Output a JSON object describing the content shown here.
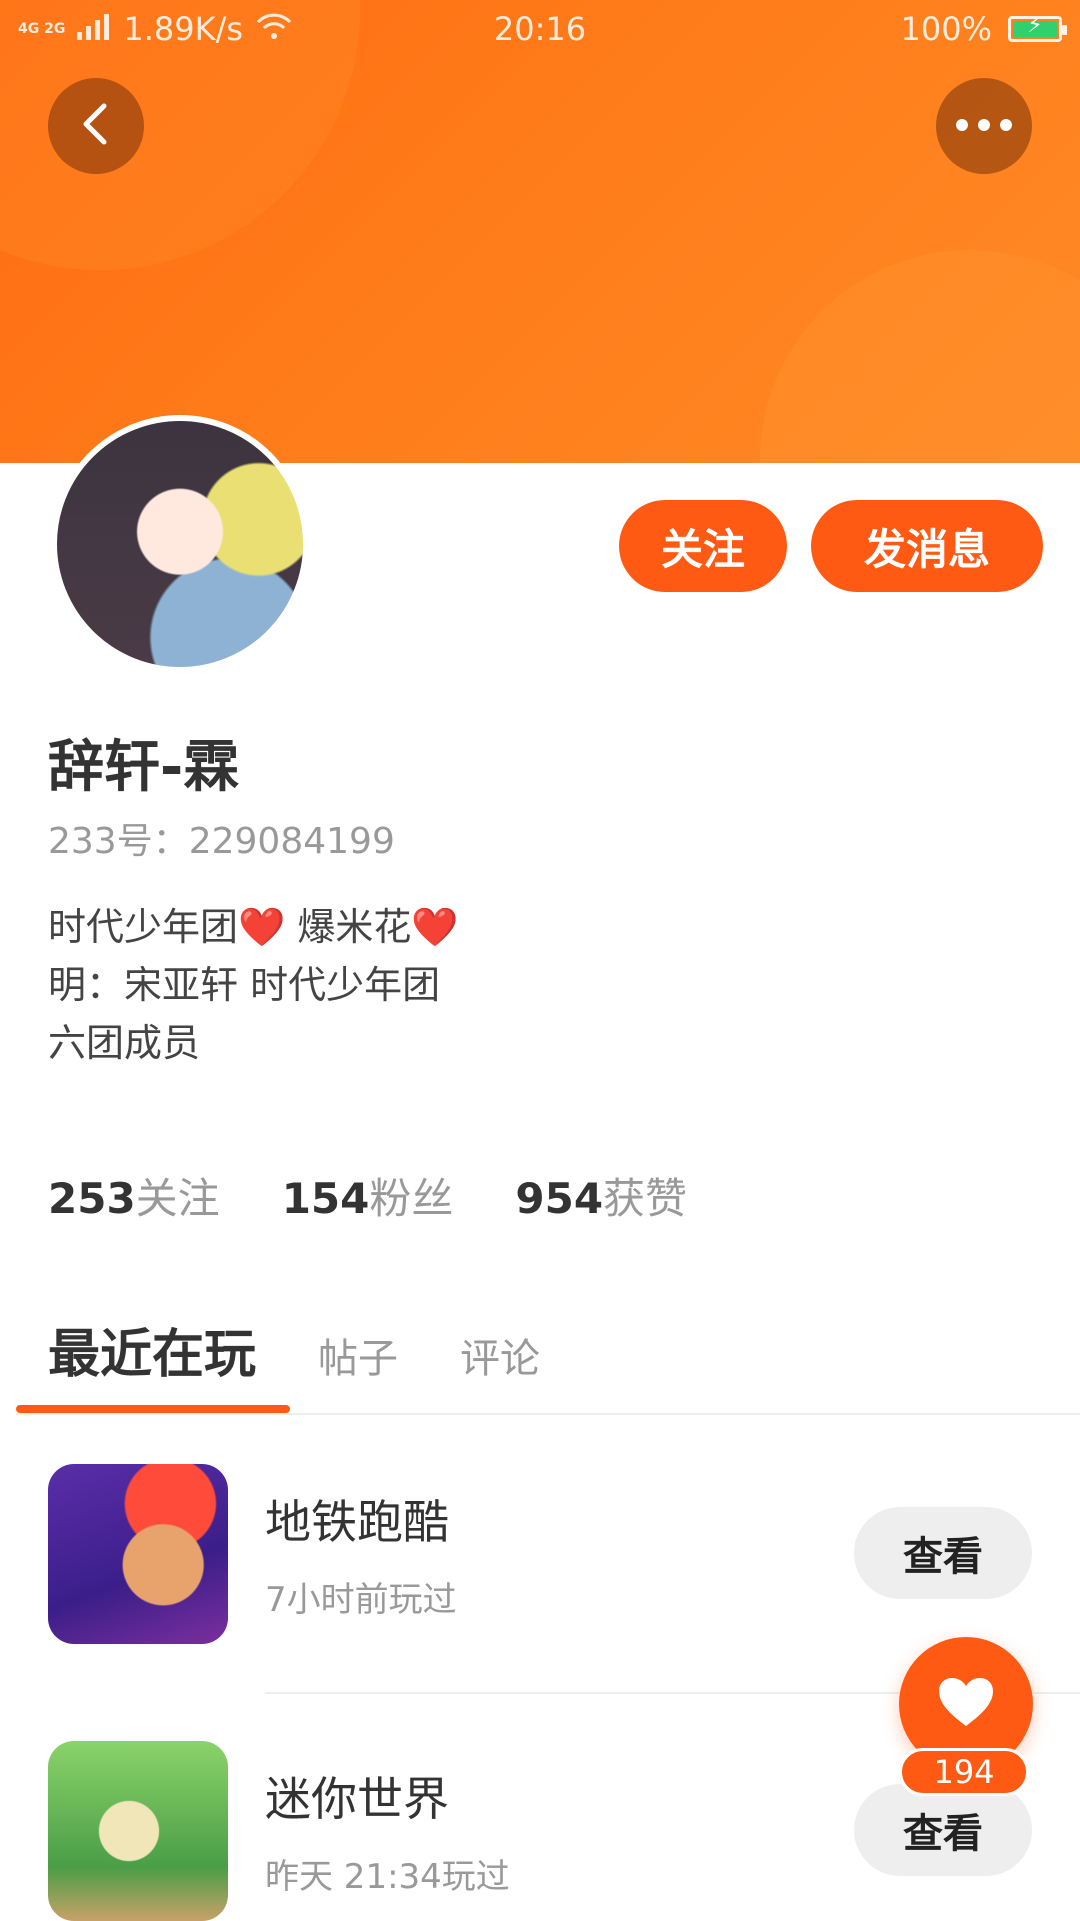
{
  "status_bar": {
    "network": "4G 2G",
    "speed": "1.89K/s",
    "time": "20:16",
    "battery": "100%"
  },
  "header": {
    "back_icon": "chevron-left-icon",
    "more_icon": "more-horizontal-icon",
    "accent_color": "#ff5a14"
  },
  "profile": {
    "follow_label": "关注",
    "message_label": "发消息",
    "username": "辞轩-霖",
    "id_text": "233号：229084199",
    "bio": [
      "时代少年团❤️ 爆米花❤️",
      "明：宋亚轩 时代少年团",
      "六团成员"
    ]
  },
  "stats": [
    {
      "value": "253",
      "label": "关注"
    },
    {
      "value": "154",
      "label": "粉丝"
    },
    {
      "value": "954",
      "label": "获赞"
    }
  ],
  "tabs": {
    "active": "最近在玩",
    "posts": "帖子",
    "comments": "评论"
  },
  "games": [
    {
      "title": "地铁跑酷",
      "subtitle": "7小时前玩过",
      "button": "查看"
    },
    {
      "title": "迷你世界",
      "subtitle": "昨天 21:34玩过",
      "button": "查看"
    }
  ],
  "like": {
    "icon": "heart-icon",
    "count": "194"
  }
}
